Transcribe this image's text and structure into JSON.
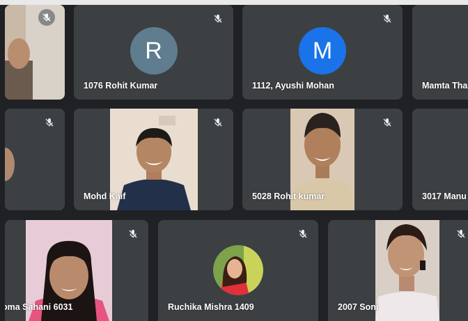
{
  "participants": [
    {
      "name": "",
      "initial": "",
      "muted": true
    },
    {
      "name": "1076 Rohit Kumar",
      "initial": "R",
      "avatar_color": "#5f7d8e",
      "muted": true
    },
    {
      "name": "1112, Ayushi Mohan",
      "initial": "M",
      "avatar_color": "#1a73e8",
      "muted": true
    },
    {
      "name": "Mamta Tha",
      "initial": "",
      "muted": false
    },
    {
      "name": "",
      "initial": "",
      "muted": true
    },
    {
      "name": "Mohd Kaif",
      "initial": "",
      "muted": true
    },
    {
      "name": "5028 Rohit kumar",
      "initial": "",
      "muted": true
    },
    {
      "name": "3017 Manu",
      "initial": "",
      "muted": false
    },
    {
      "name": "oma Sahani 6031",
      "initial": "",
      "muted": true
    },
    {
      "name": "Ruchika Mishra 1409",
      "initial": "",
      "muted": true
    },
    {
      "name": "2007 Soni",
      "initial": "",
      "muted": true
    }
  ]
}
